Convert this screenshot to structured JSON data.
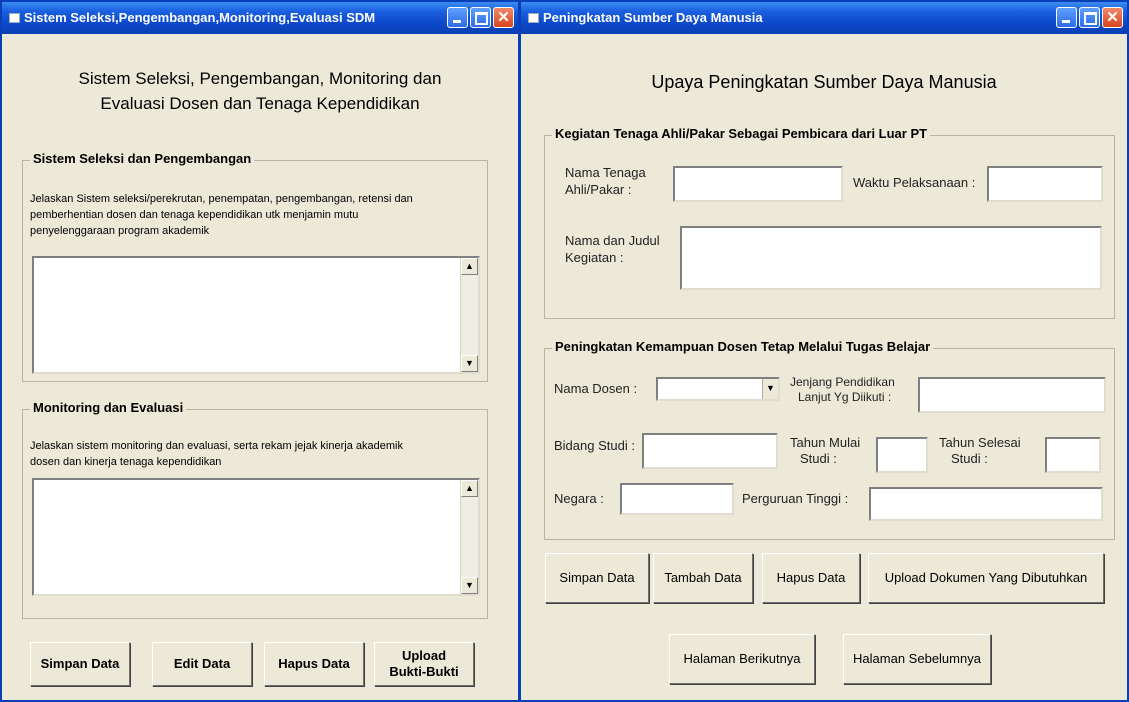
{
  "left_window": {
    "title": "Sistem Seleksi,Pengembangan,Monitoring,Evaluasi SDM",
    "heading_line1": "Sistem Seleksi, Pengembangan, Monitoring dan",
    "heading_line2": "Evaluasi Dosen dan Tenaga Kependidikan",
    "group1": {
      "legend": "Sistem Seleksi dan Pengembangan",
      "desc_line1": "Jelaskan Sistem seleksi/perekrutan, penempatan, pengembangan, retensi dan",
      "desc_line2": "pemberhentian dosen dan tenaga kependidikan utk menjamin mutu",
      "desc_line3": "penyelenggaraan program akademik"
    },
    "group2": {
      "legend": "Monitoring dan Evaluasi",
      "desc_line1": "Jelaskan sistem monitoring dan evaluasi, serta rekam jejak kinerja akademik",
      "desc_line2": "dosen dan kinerja tenaga kependidikan"
    },
    "buttons": {
      "save": "Simpan Data",
      "edit": "Edit Data",
      "delete": "Hapus  Data",
      "upload_line1": "Upload",
      "upload_line2": "Bukti-Bukti"
    }
  },
  "right_window": {
    "title": "Peningkatan Sumber Daya Manusia",
    "heading": "Upaya Peningkatan Sumber Daya Manusia",
    "group1": {
      "legend": "Kegiatan Tenaga Ahli/Pakar Sebagai Pembicara dari Luar PT",
      "expert_name_label_line1": "Nama Tenaga",
      "expert_name_label_line2": "Ahli/Pakar :",
      "time_label": "Waktu Pelaksanaan :",
      "activity_label_line1": "Nama dan Judul",
      "activity_label_line2": "Kegiatan :"
    },
    "group2": {
      "legend": "Peningkatan Kemampuan Dosen Tetap Melalui Tugas Belajar",
      "lecturer_label": "Nama Dosen :",
      "level_label_line1": "Jenjang Pendidikan",
      "level_label_line2": "Lanjut Yg Diikuti :",
      "field_label": "Bidang Studi :",
      "start_label_line1": "Tahun Mulai",
      "start_label_line2": "Studi :",
      "end_label_line1": "Tahun Selesai",
      "end_label_line2": "Studi :",
      "country_label": "Negara :",
      "university_label": "Perguruan Tinggi :"
    },
    "buttons": {
      "save": "Simpan Data",
      "add": "Tambah Data",
      "delete": "Hapus Data",
      "upload": "Upload Dokumen Yang Dibutuhkan",
      "next": "Halaman Berikutnya",
      "prev": "Halaman Sebelumnya"
    }
  }
}
